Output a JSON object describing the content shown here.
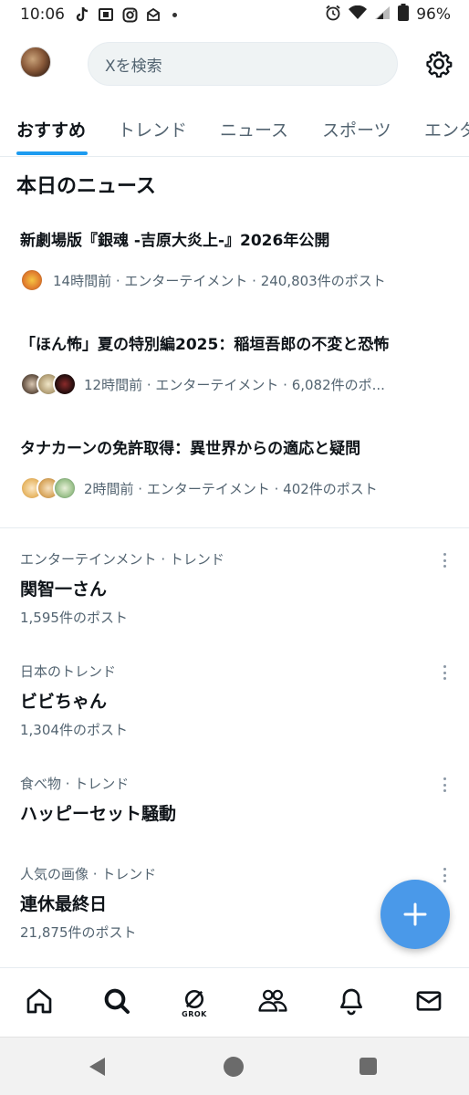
{
  "status_bar": {
    "time": "10:06",
    "battery": "96%",
    "icons": [
      "tiktok-icon",
      "app-icon",
      "instagram-icon",
      "mail-icon",
      "dot-icon",
      "alarm-icon",
      "wifi-icon",
      "signal-icon",
      "battery-icon"
    ]
  },
  "header": {
    "search_placeholder": "Xを検索"
  },
  "tabs": [
    {
      "label": "おすすめ",
      "active": true
    },
    {
      "label": "トレンド"
    },
    {
      "label": "ニュース"
    },
    {
      "label": "スポーツ"
    },
    {
      "label": "エンタ"
    }
  ],
  "news": {
    "title": "本日のニュース",
    "items": [
      {
        "headline": "新劇場版『銀魂 -吉原大炎上-』2026年公開",
        "meta": "14時間前 · エンターテイメント · 240,803件のポスト"
      },
      {
        "headline": "「ほん怖」夏の特別編2025：稲垣吾郎の不変と恐怖",
        "meta": "12時間前 · エンターテイメント · 6,082件のポ..."
      },
      {
        "headline": "タナカーンの免許取得：異世界からの適応と疑問",
        "meta": "2時間前 · エンターテイメント · 402件のポスト"
      }
    ]
  },
  "trends": [
    {
      "category": "エンターテインメント · トレンド",
      "name": "関智一さん",
      "count": "1,595件のポスト"
    },
    {
      "category": "日本のトレンド",
      "name": "ビビちゃん",
      "count": "1,304件のポスト"
    },
    {
      "category": "食べ物 · トレンド",
      "name": "ハッピーセット騒動",
      "count": ""
    },
    {
      "category": "人気の画像 · トレンド",
      "name": "連休最終日",
      "count": "21,875件のポスト"
    }
  ],
  "bottom_nav": {
    "grok_label": "GROK"
  },
  "colors": {
    "accent": "#1d9bf0",
    "fab": "#4a99e9",
    "secondary_text": "#536471"
  }
}
